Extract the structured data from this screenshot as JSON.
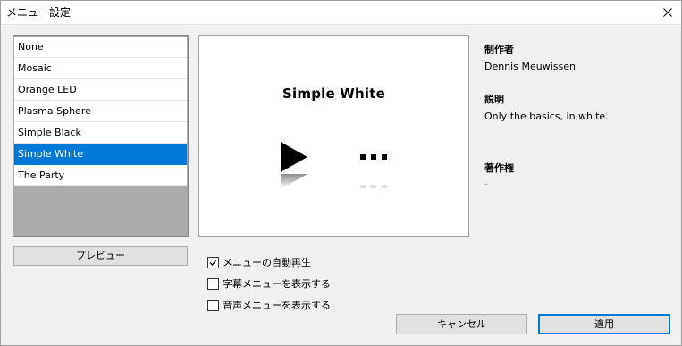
{
  "window": {
    "title": "メニュー設定"
  },
  "menu_list": {
    "items": [
      {
        "label": "None"
      },
      {
        "label": "Mosaic"
      },
      {
        "label": "Orange LED"
      },
      {
        "label": "Plasma Sphere"
      },
      {
        "label": "Simple Black"
      },
      {
        "label": "Simple White",
        "selected": true
      },
      {
        "label": "The Party"
      }
    ],
    "selected_index": 5
  },
  "preview_button": {
    "label": "プレビュー"
  },
  "preview": {
    "title": "Simple White",
    "play_icon": "play-icon",
    "more_icon": "ellipsis-icon"
  },
  "info": {
    "author_label": "制作者",
    "author_value": "Dennis Meuwissen",
    "description_label": "説明",
    "description_value": "Only the basics, in white.",
    "copyright_label": "著作権",
    "copyright_value": "-"
  },
  "options": {
    "autoplay": {
      "label": "メニューの自動再生",
      "checked": true
    },
    "subtitle_menu": {
      "label": "字幕メニューを表示する",
      "checked": false
    },
    "audio_menu": {
      "label": "音声メニューを表示する",
      "checked": false
    }
  },
  "buttons": {
    "cancel": "キャンセル",
    "apply": "適用"
  },
  "colors": {
    "selection": "#0078d7",
    "accent_border": "#0078d7",
    "list_empty_area": "#ababab"
  }
}
